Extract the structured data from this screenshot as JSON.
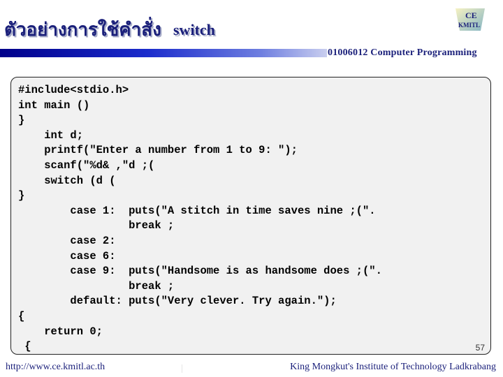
{
  "header": {
    "title_thai": "ตัวอย่างการใช้คำสั่ง",
    "title_keyword": "switch",
    "course": "01006012 Computer Programming",
    "logo": {
      "top_text": "CE",
      "bottom_text": "KMITL",
      "icon": "ce-kmitl-logo-icon"
    }
  },
  "code": {
    "lines": [
      "#include<stdio.h>",
      "int main ()",
      "}",
      "    int d;",
      "    printf(\"Enter a number from 1 to 9: \");",
      "    scanf(\"%d& ,\"d ;(",
      "    switch (d (",
      "}",
      "        case 1:  puts(\"A stitch in time saves nine ;(\".",
      "                 break ;",
      "        case 2:",
      "        case 6:",
      "        case 9:  puts(\"Handsome is as handsome does ;(\".",
      "                 break ;",
      "        default: puts(\"Very clever. Try again.\");",
      "{",
      "    return 0;",
      " {"
    ]
  },
  "page_number": "57",
  "footer": {
    "url": "http://www.ce.kmitl.ac.th",
    "institute": "King Mongkut's Institute of Technology Ladkrabang"
  },
  "colors": {
    "title": "#1a1f7a",
    "bar_start": "#00008a",
    "bar_end": "#c9ceef",
    "code_bg": "#f1f1f1"
  }
}
